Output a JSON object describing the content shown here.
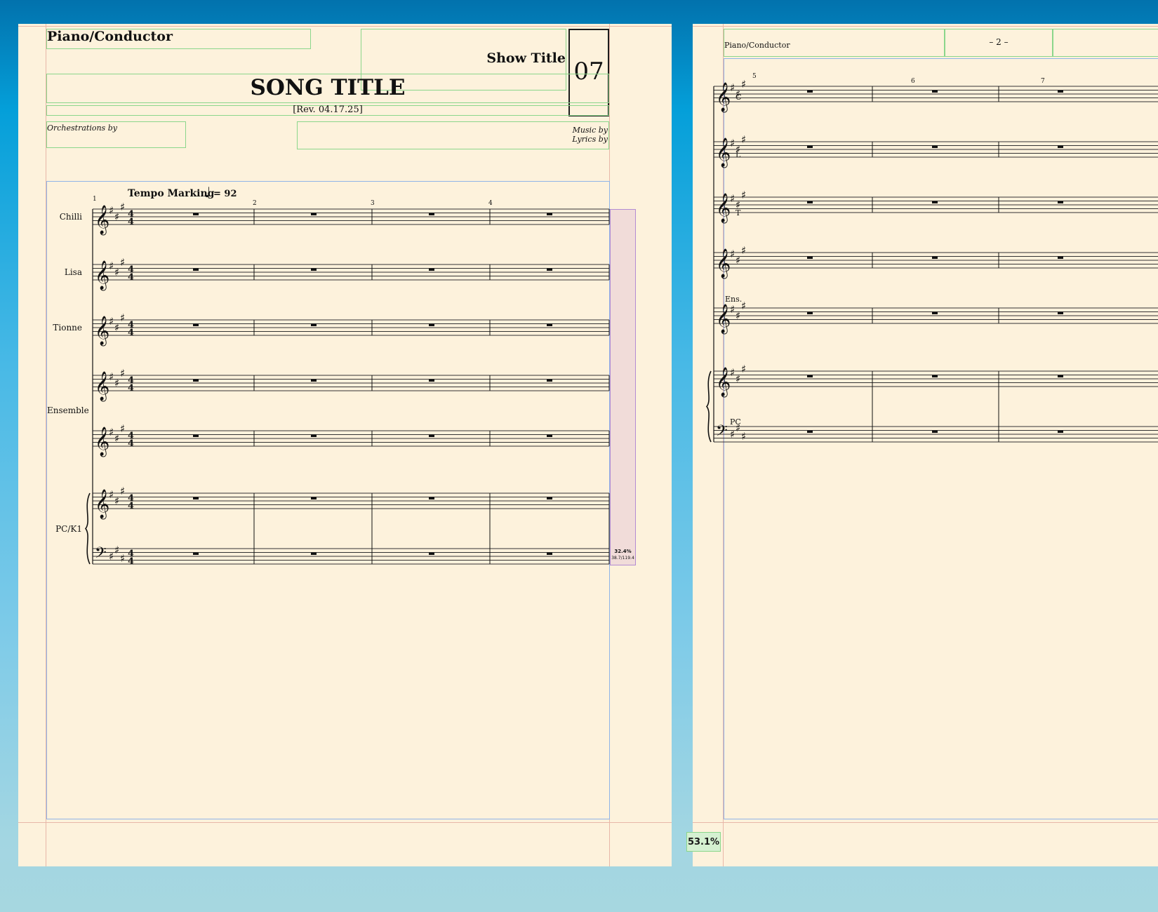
{
  "page1": {
    "part_name": "Piano/Conductor",
    "show_title": "Show Title",
    "song_number": "07",
    "song_title": "SONG TITLE",
    "revision": "[Rev. 04.17.25]",
    "orchestrations_by": "Orchestrations by",
    "music_by": "Music by",
    "lyrics_by": "Lyrics by",
    "tempo_marking": "Tempo Marking",
    "tempo_value": "= 92",
    "measure_numbers": [
      "1",
      "2",
      "3",
      "4"
    ],
    "staff_labels": {
      "chilli": "Chilli",
      "lisa": "Lisa",
      "tionne": "Tionne",
      "ensemble": "Ensemble",
      "pc_k1": "PC/K1"
    },
    "spacing_percent": "32.4%",
    "spacing_ratio": "38.7/119.4"
  },
  "page2": {
    "part_name": "Piano/Conductor",
    "page_number": "– 2 –",
    "measure_numbers": [
      "5",
      "6",
      "7"
    ],
    "staff_labels": {
      "c": "C",
      "l": "L",
      "t": "T",
      "ens": "Ens.",
      "pc": "PC"
    }
  },
  "zoom_level": "53.1%"
}
